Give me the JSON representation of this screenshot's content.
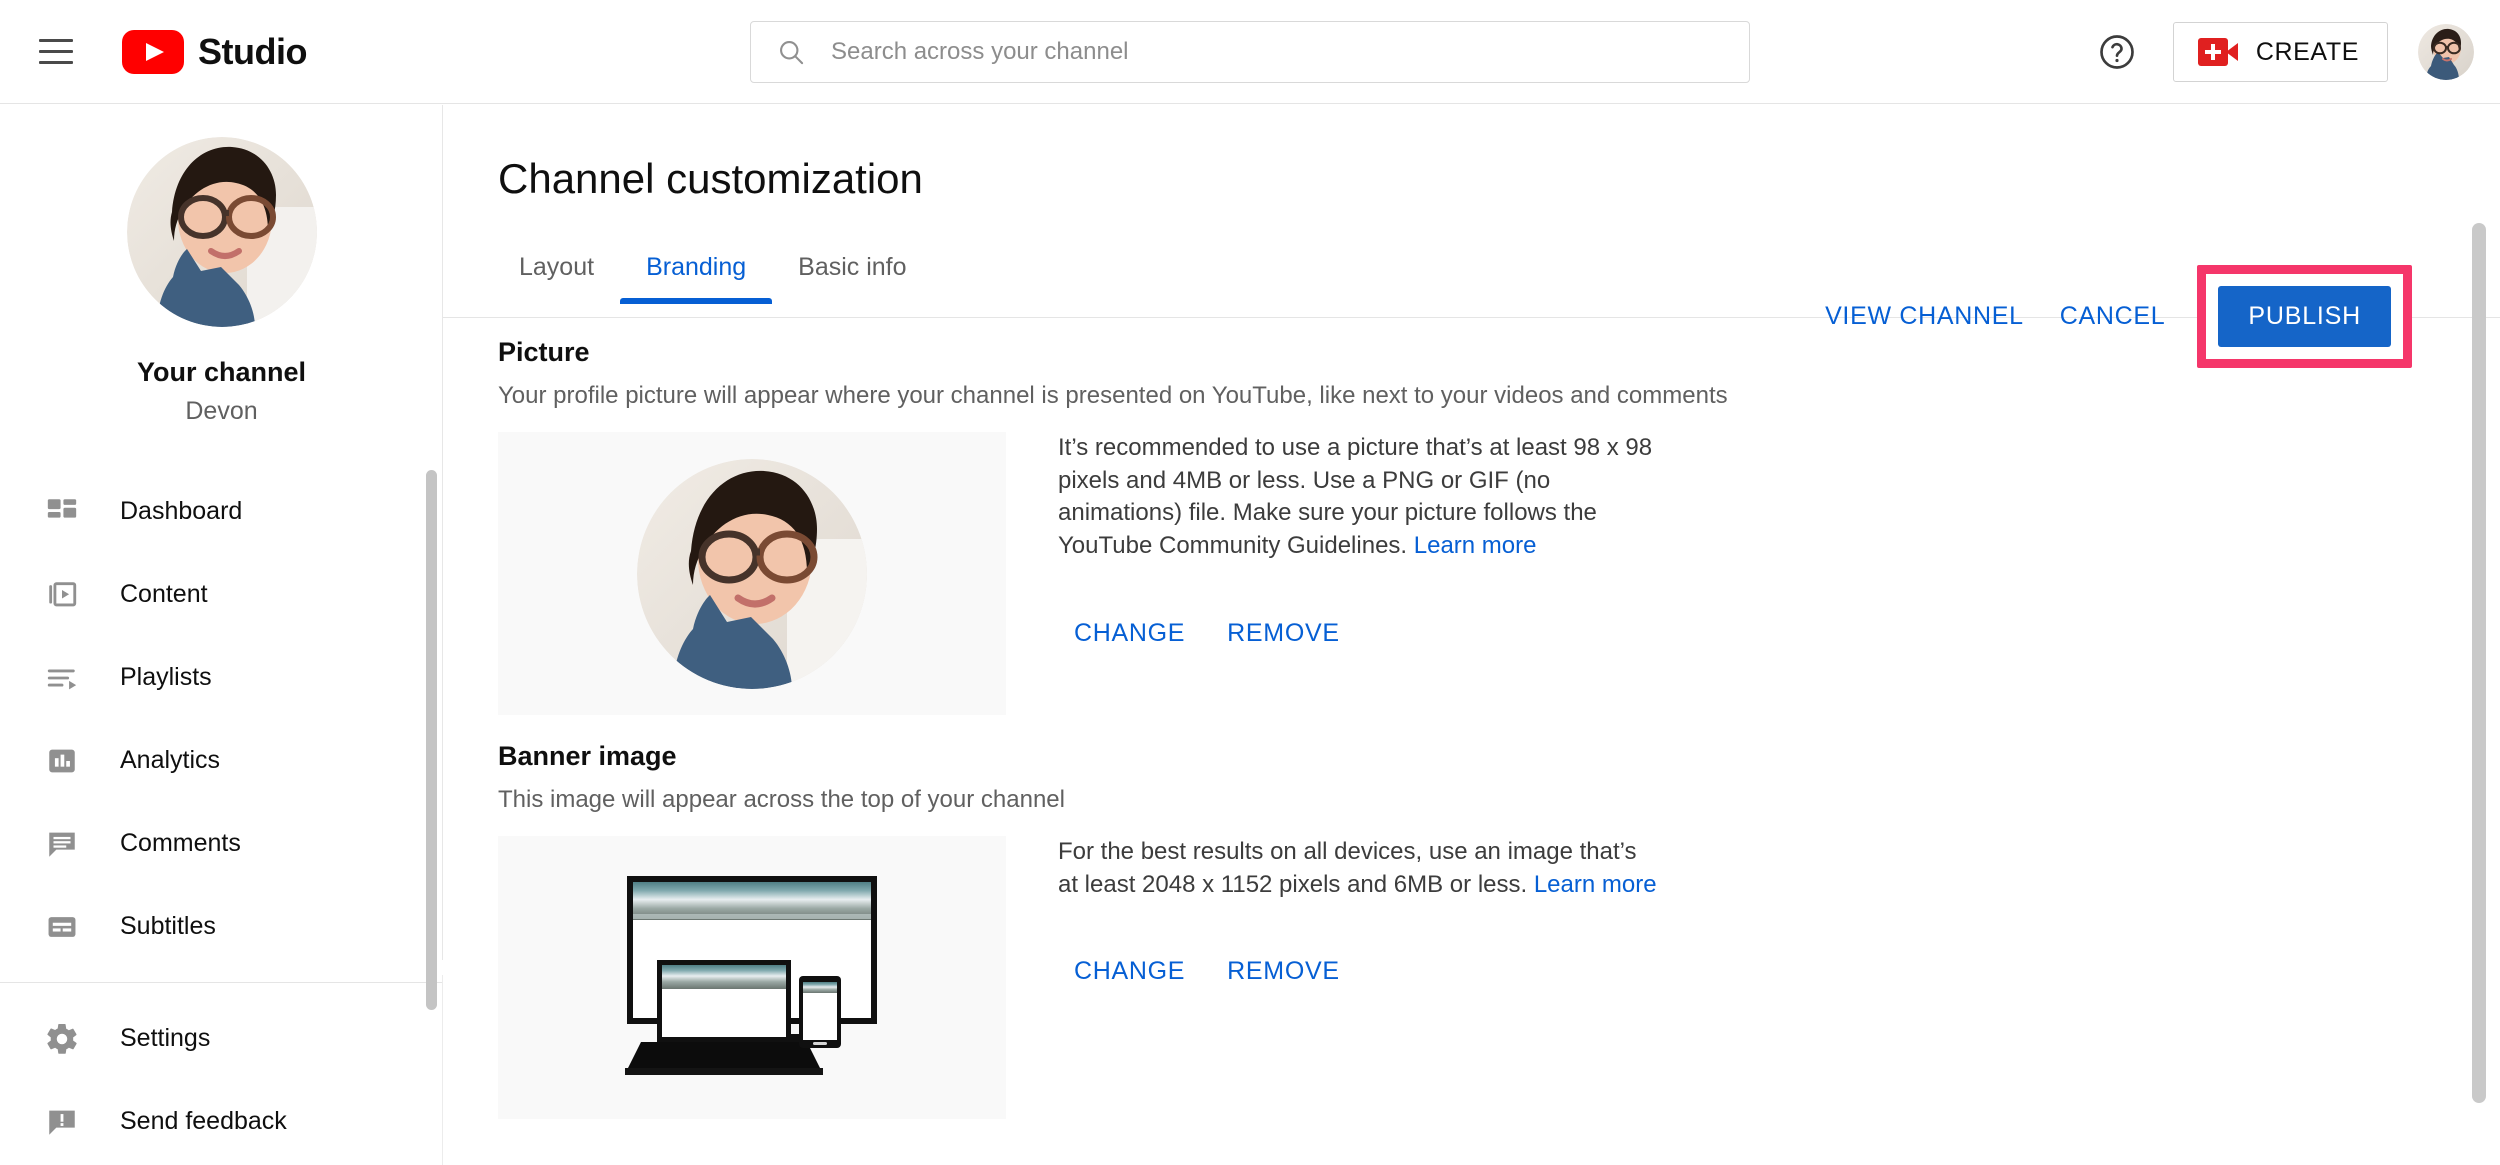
{
  "header": {
    "menu_icon": "hamburger-menu-icon",
    "logo_icon": "youtube-logo-icon",
    "brand": "Studio",
    "search": {
      "placeholder": "Search across your channel",
      "value": "",
      "icon": "search-icon"
    },
    "help_icon": "help-circle-icon",
    "create_label": "CREATE",
    "create_icon": "video-camera-plus-icon",
    "account_avatar": "account-avatar"
  },
  "sidebar": {
    "avatar": "channel-avatar",
    "channel_title": "Your channel",
    "channel_name": "Devon",
    "items": [
      {
        "label": "Dashboard",
        "icon": "dashboard-grid-icon"
      },
      {
        "label": "Content",
        "icon": "video-stack-icon"
      },
      {
        "label": "Playlists",
        "icon": "playlist-icon"
      },
      {
        "label": "Analytics",
        "icon": "bar-chart-icon"
      },
      {
        "label": "Comments",
        "icon": "comment-bubble-icon"
      },
      {
        "label": "Subtitles",
        "icon": "subtitles-icon"
      }
    ],
    "footer_items": [
      {
        "label": "Settings",
        "icon": "gear-icon"
      },
      {
        "label": "Send feedback",
        "icon": "feedback-bubble-icon"
      }
    ]
  },
  "main": {
    "title": "Channel customization",
    "tabs": [
      {
        "label": "Layout",
        "active": false
      },
      {
        "label": "Branding",
        "active": true
      },
      {
        "label": "Basic info",
        "active": false
      }
    ],
    "actions": {
      "view_channel": "VIEW CHANNEL",
      "cancel": "CANCEL",
      "publish": "PUBLISH",
      "publish_highlight_color": "#f5366a",
      "publish_button_color": "#1565c8"
    },
    "sections": [
      {
        "title": "Picture",
        "description": "Your profile picture will appear where your channel is presented on YouTube, like next to your videos and comments",
        "help_text": "It’s recommended to use a picture that’s at least 98 x 98 pixels and 4MB or less. Use a PNG or GIF (no animations) file. Make sure your picture follows the YouTube Community Guidelines. ",
        "learn_more": "Learn more",
        "change": "CHANGE",
        "remove": "REMOVE",
        "preview_icon": "profile-picture-preview"
      },
      {
        "title": "Banner image",
        "description": "This image will appear across the top of your channel",
        "help_text": "For the best results on all devices, use an image that’s at least 2048 x 1152 pixels and 6MB or less. ",
        "learn_more": "Learn more",
        "change": "CHANGE",
        "remove": "REMOVE",
        "preview_icon": "banner-devices-preview"
      }
    ]
  },
  "colors": {
    "accent_blue": "#065fd4",
    "brand_red": "#ff0000",
    "highlight_pink": "#f5366a",
    "text_primary": "#0f0f0f",
    "text_secondary": "#606060"
  }
}
